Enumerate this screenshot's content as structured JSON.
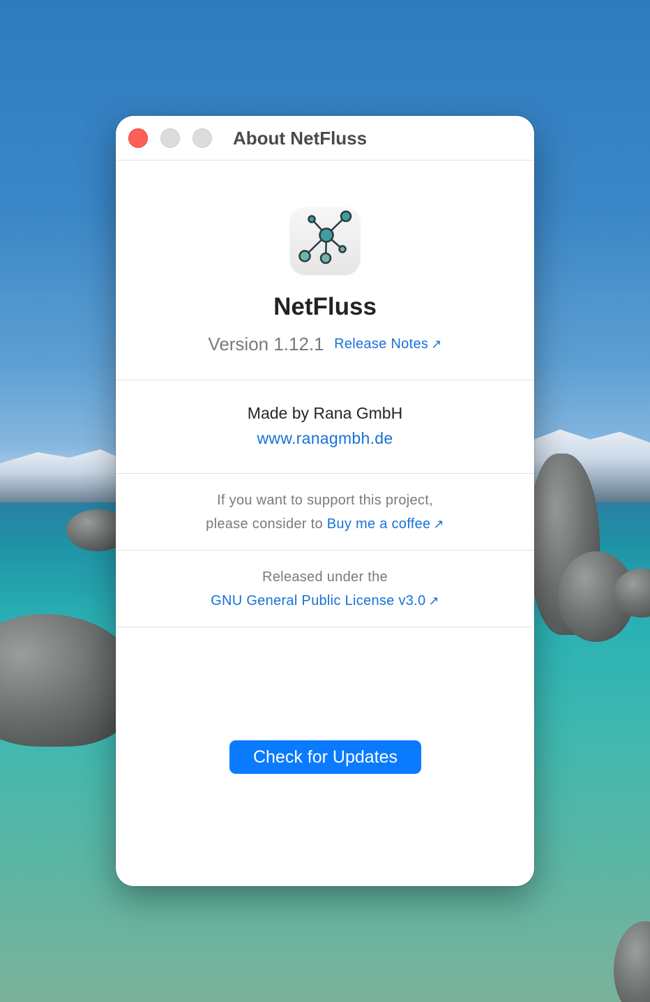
{
  "window": {
    "title": "About NetFluss",
    "controls": [
      "close",
      "minimize",
      "zoom"
    ]
  },
  "app": {
    "icon": "network-graph-icon",
    "name": "NetFluss",
    "version_label": "Version 1.12.1",
    "release_notes_label": "Release Notes",
    "external_arrow": "↗"
  },
  "maker": {
    "made_by": "Made by Rana GmbH",
    "website": "www.ranagmbh.de"
  },
  "support": {
    "line1": "If you want to support this project,",
    "line2_prefix": "please consider to",
    "link_label": "Buy me a coffee"
  },
  "license": {
    "line1": "Released under the",
    "link_label": "GNU General Public License v3.0"
  },
  "actions": {
    "check_updates_label": "Check for Updates"
  },
  "colors": {
    "accent": "#0a7aff",
    "link": "#1772d6",
    "close": "#fe5f57"
  }
}
